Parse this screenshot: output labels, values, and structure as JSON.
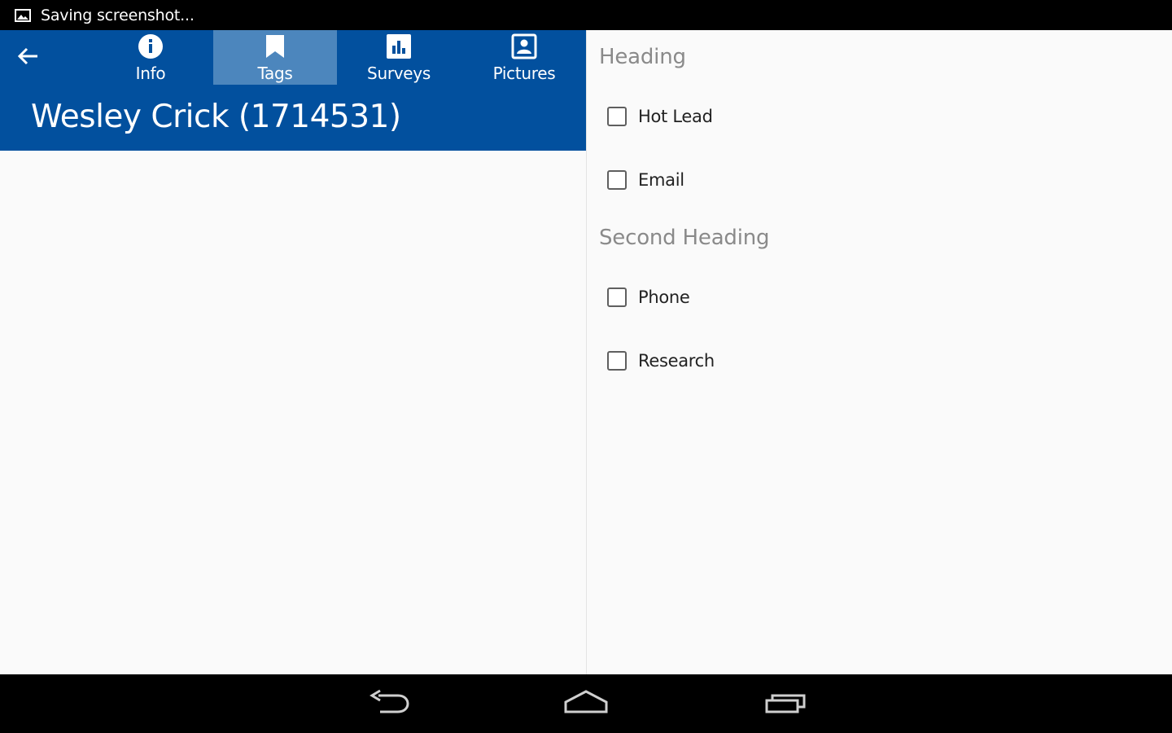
{
  "status_bar": {
    "text": "Saving screenshot...",
    "icon": "screenshot-icon"
  },
  "header": {
    "back_icon": "arrow-back-icon",
    "title": "Wesley Crick (1714531)",
    "tabs": [
      {
        "label": "Info",
        "icon": "info-icon",
        "selected": false
      },
      {
        "label": "Tags",
        "icon": "bookmark-icon",
        "selected": true
      },
      {
        "label": "Surveys",
        "icon": "bar-chart-icon",
        "selected": false
      },
      {
        "label": "Pictures",
        "icon": "portrait-icon",
        "selected": false
      }
    ],
    "color": "#02509e",
    "selected_tab_color": "#4c86bd"
  },
  "tags_panel": {
    "sections": [
      {
        "heading": "Heading",
        "items": [
          {
            "label": "Hot Lead",
            "checked": false
          },
          {
            "label": "Email",
            "checked": false
          }
        ]
      },
      {
        "heading": "Second Heading",
        "items": [
          {
            "label": "Phone",
            "checked": false
          },
          {
            "label": "Research",
            "checked": false
          }
        ]
      }
    ]
  },
  "nav_bar": {
    "buttons": [
      "back-nav-icon",
      "home-nav-icon",
      "recents-nav-icon"
    ]
  }
}
